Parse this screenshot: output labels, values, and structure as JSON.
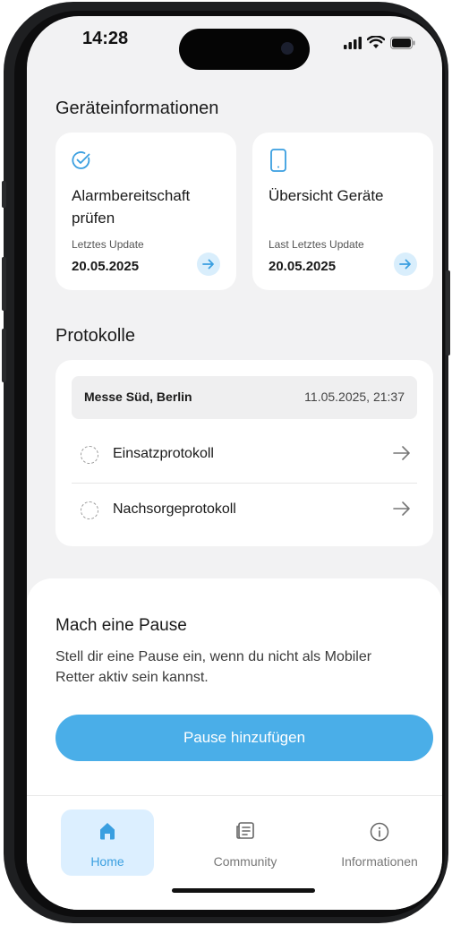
{
  "status_bar": {
    "time": "14:28"
  },
  "sections": {
    "device_info": "Geräteinformationen",
    "protocols": "Protokolle"
  },
  "cards": [
    {
      "icon": "check-circle-icon",
      "title_line1": "Alarmbereitschaft",
      "title_line2": "prüfen",
      "label": "Letztes Update",
      "date": "20.05.2025"
    },
    {
      "icon": "phone-icon",
      "title_line1": "Übersicht Geräte",
      "title_line2": "",
      "label": "Last Letztes Update",
      "date": "20.05.2025"
    }
  ],
  "protocol": {
    "location": "Messe Süd, Berlin",
    "datetime": "11.05.2025, 21:37",
    "items": [
      {
        "label": "Einsatzprotokoll"
      },
      {
        "label": "Nachsorgeprotokoll"
      }
    ]
  },
  "pause": {
    "title": "Mach eine Pause",
    "description": "Stell dir eine Pause ein, wenn du nicht als Mobiler Retter aktiv sein kannst.",
    "button": "Pause hinzufügen"
  },
  "tabs": [
    {
      "label": "Home",
      "icon": "home-icon",
      "active": true
    },
    {
      "label": "Community",
      "icon": "newspaper-icon",
      "active": false
    },
    {
      "label": "Informationen",
      "icon": "info-icon",
      "active": false
    }
  ],
  "colors": {
    "accent": "#4aaee8",
    "accent_light": "#d9eefc",
    "tab_active": "#3a9fe0",
    "background": "#f2f2f3"
  }
}
